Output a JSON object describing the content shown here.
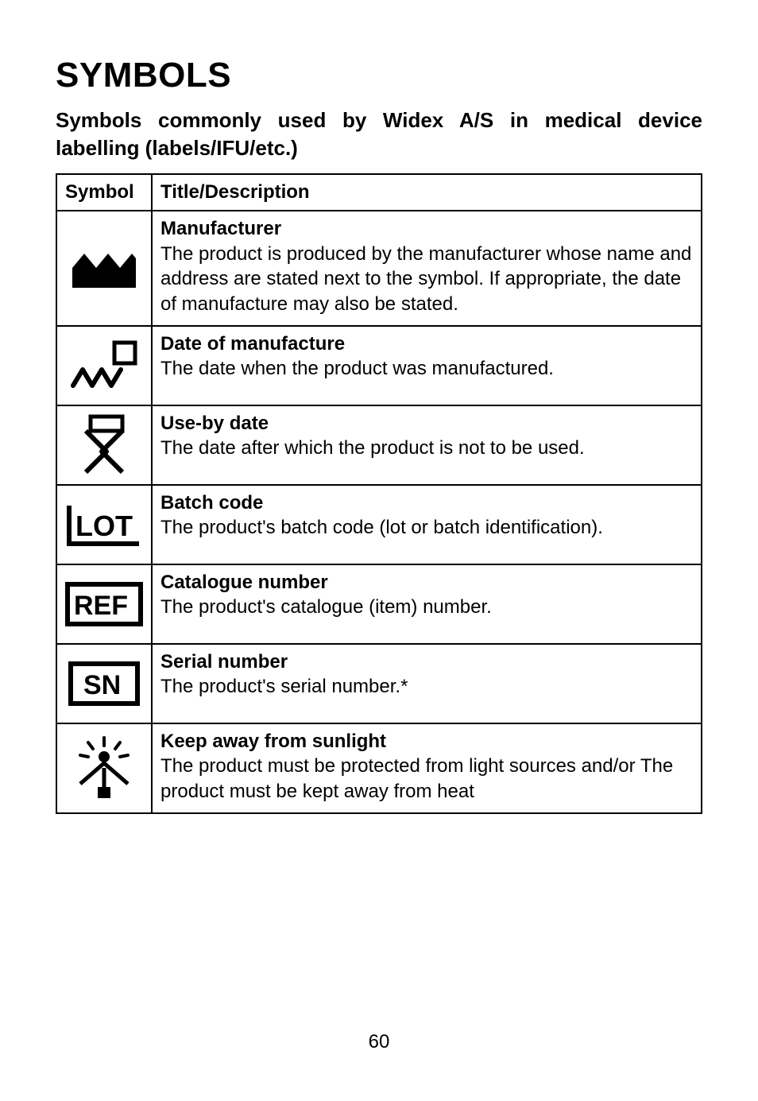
{
  "title": "SYMBOLS",
  "subtitle": "Symbols commonly used by Widex A/S in medical device labelling (labels/IFU/etc.)",
  "headers": {
    "symbol": "Symbol",
    "desc": "Title/Description"
  },
  "rows": [
    {
      "icon": "manufacturer-icon",
      "title": "Manufacturer",
      "body": "The product is produced by the manufacturer whose name and address are stated next to the symbol. If appropriate, the date of manufacture may also be stated."
    },
    {
      "icon": "date-manufacture-icon",
      "title": "Date of manufacture",
      "body": "The date when the product was manufactured."
    },
    {
      "icon": "use-by-icon",
      "title": "Use-by date",
      "body": "The date after which the product is not to be used."
    },
    {
      "icon": "lot-icon",
      "title": "Batch code",
      "body": "The product's batch code (lot or batch identification)."
    },
    {
      "icon": "ref-icon",
      "title": "Catalogue number",
      "body": "The product's catalogue (item) number."
    },
    {
      "icon": "sn-icon",
      "title": "Serial number",
      "body": "The product's serial number.*"
    },
    {
      "icon": "sunlight-icon",
      "title": "Keep away from sunlight",
      "body": "The product must be protected from light sources and/or The product must be kept away from heat"
    }
  ],
  "icon_text": {
    "lot": "LOT",
    "ref": "REF",
    "sn": "SN"
  },
  "page_number": "60"
}
